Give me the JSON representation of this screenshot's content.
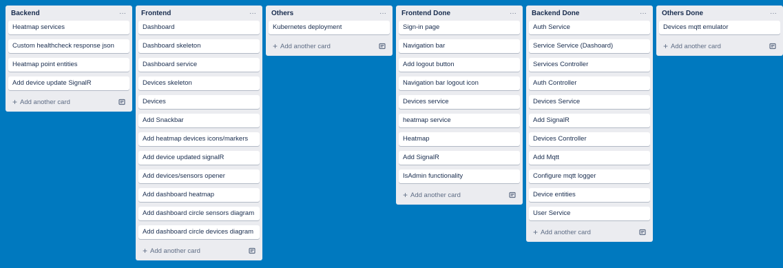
{
  "board": {
    "add_card_label": "Add another card",
    "menu_glyph": "···",
    "lists": [
      {
        "title": "Backend",
        "cards": [
          "Heatmap services",
          "Custom healthcheck response json",
          "Heatmap point entities",
          "Add device update SignalR"
        ]
      },
      {
        "title": "Frontend",
        "cards": [
          "Dashboard",
          "Dashboard skeleton",
          "Dashboard service",
          "Devices skeleton",
          "Devices",
          "Add Snackbar",
          "Add heatmap devices icons/markers",
          "Add device updated signalR",
          "Add devices/sensors opener",
          "Add dashboard heatmap",
          "Add dashboard circle sensors diagram",
          "Add dashboard circle devices diagram"
        ]
      },
      {
        "title": "Others",
        "cards": [
          "Kubernetes deployment"
        ]
      },
      {
        "title": "Frontend Done",
        "cards": [
          "Sign-in page",
          "Navigation bar",
          "Add logout button",
          "Navigation bar logout icon",
          "Devices service",
          "heatmap service",
          "Heatmap",
          "Add SignalR",
          "IsAdmin functionality"
        ]
      },
      {
        "title": "Backend Done",
        "cards": [
          "Auth Service",
          "Service Service (Dashoard)",
          "Services Controller",
          "Auth Controller",
          "Devices Service",
          "Add SignalR",
          "Devices Controller",
          "Add Mqtt",
          "Configure mqtt logger",
          "Device entities",
          "User Service"
        ]
      },
      {
        "title": "Others Done",
        "cards": [
          "Devices mqtt emulator"
        ]
      }
    ]
  },
  "colors": {
    "board_background": "#0079bf",
    "list_background": "#ebecf0",
    "card_background": "#ffffff",
    "text": "#172b4d",
    "muted_text": "#5e6c84"
  }
}
